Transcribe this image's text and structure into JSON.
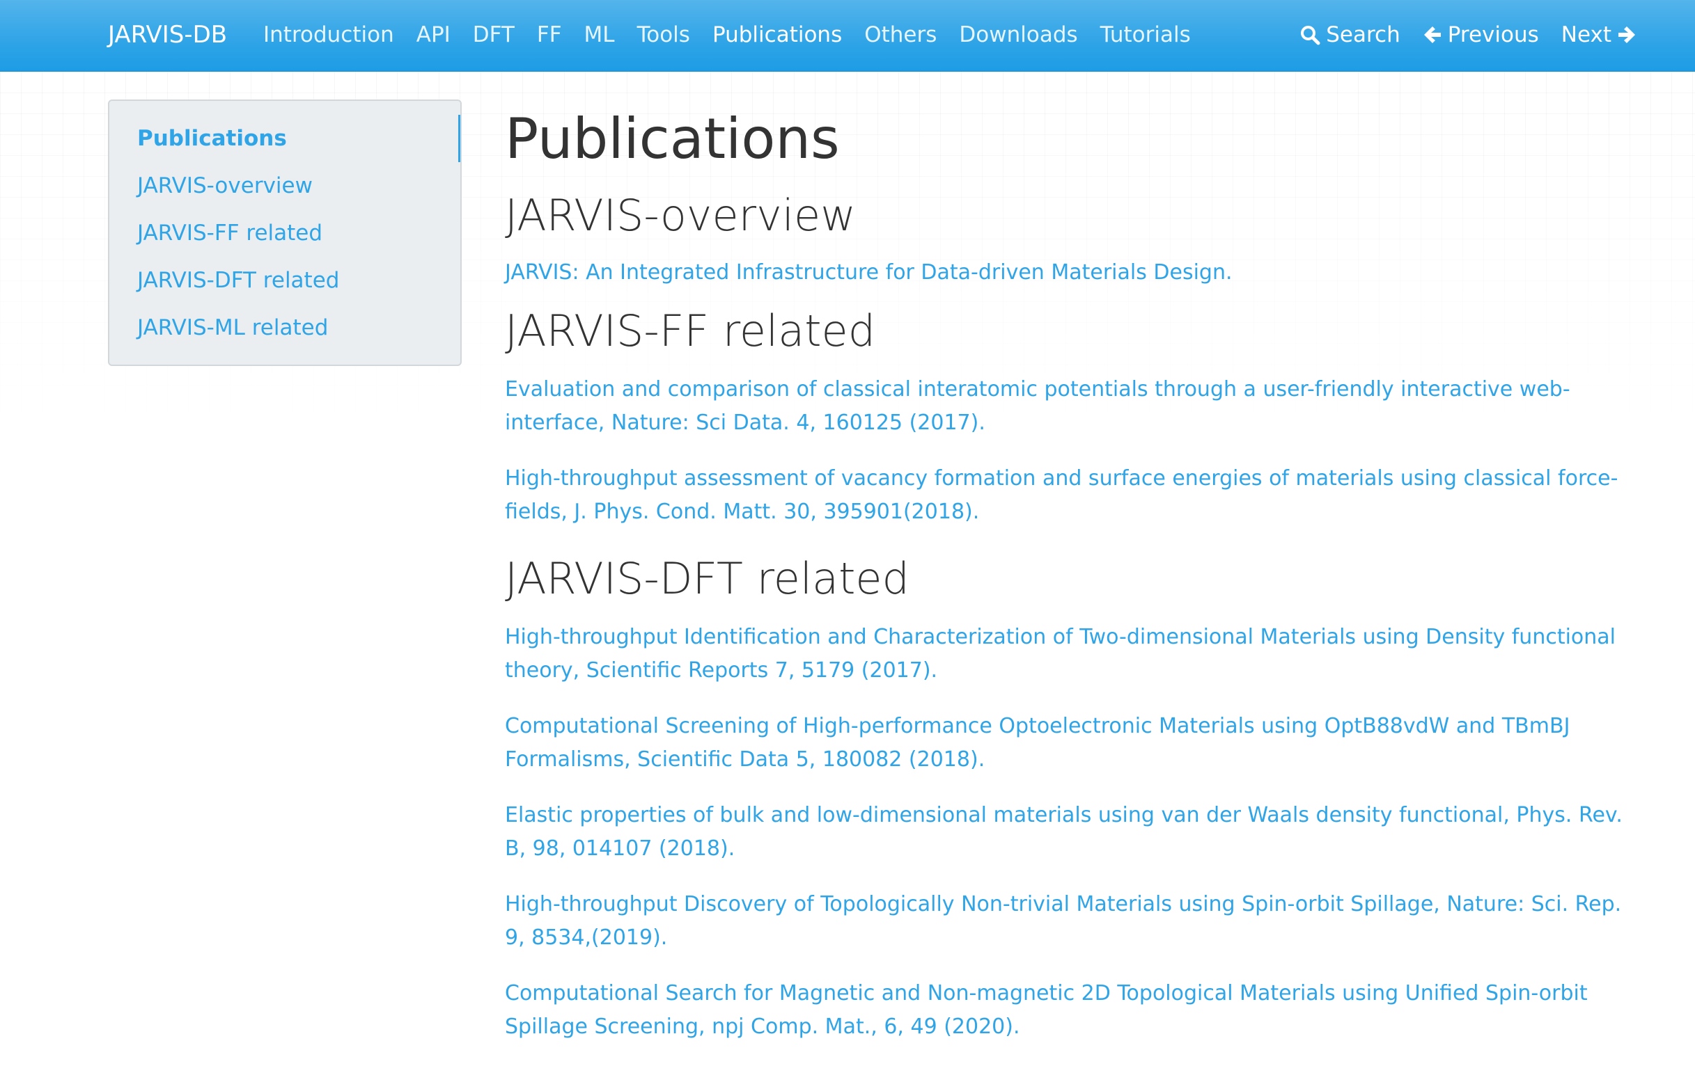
{
  "navbar": {
    "brand": "JARVIS-DB",
    "links": [
      {
        "label": "Introduction"
      },
      {
        "label": "API"
      },
      {
        "label": "DFT"
      },
      {
        "label": "FF"
      },
      {
        "label": "ML"
      },
      {
        "label": "Tools"
      },
      {
        "label": "Publications",
        "active": true
      },
      {
        "label": "Others"
      },
      {
        "label": "Downloads"
      },
      {
        "label": "Tutorials"
      }
    ],
    "search_label": "Search",
    "previous_label": "Previous",
    "next_label": "Next"
  },
  "sidebar": {
    "items": [
      {
        "label": "Publications",
        "active": true
      },
      {
        "label": "JARVIS-overview"
      },
      {
        "label": "JARVIS-FF related"
      },
      {
        "label": "JARVIS-DFT related"
      },
      {
        "label": "JARVIS-ML related"
      }
    ]
  },
  "main": {
    "title": "Publications",
    "sections": [
      {
        "heading": "JARVIS-overview",
        "items": [
          "JARVIS: An Integrated Infrastructure for Data-driven Materials Design."
        ]
      },
      {
        "heading": "JARVIS-FF related",
        "items": [
          "Evaluation and comparison of classical interatomic potentials through a user-friendly interactive web-interface, Nature: Sci Data. 4, 160125 (2017).",
          "High-throughput assessment of vacancy formation and surface energies of materials using classical force-fields, J. Phys. Cond. Matt. 30, 395901(2018)."
        ]
      },
      {
        "heading": "JARVIS-DFT related",
        "items": [
          "High-throughput Identification and Characterization of Two-dimensional Materials using Density functional theory, Scientific Reports 7, 5179 (2017).",
          "Computational Screening of High-performance Optoelectronic Materials using OptB88vdW and TBmBJ Formalisms, Scientific Data 5, 180082 (2018).",
          "Elastic properties of bulk and low-dimensional materials using van der Waals density functional, Phys. Rev. B, 98, 014107 (2018).",
          "High-throughput Discovery of Topologically Non-trivial Materials using Spin-orbit Spillage, Nature: Sci. Rep. 9, 8534,(2019).",
          "Computational Search for Magnetic and Non-magnetic 2D Topological Materials using Unified Spin-orbit Spillage Screening, npj Comp. Mat., 6, 49 (2020)."
        ]
      }
    ]
  },
  "colors": {
    "navbar": "#2fa4e7",
    "link": "#2fa4e7",
    "heading": "#333333",
    "sidebar_bg": "#ebeef1"
  }
}
